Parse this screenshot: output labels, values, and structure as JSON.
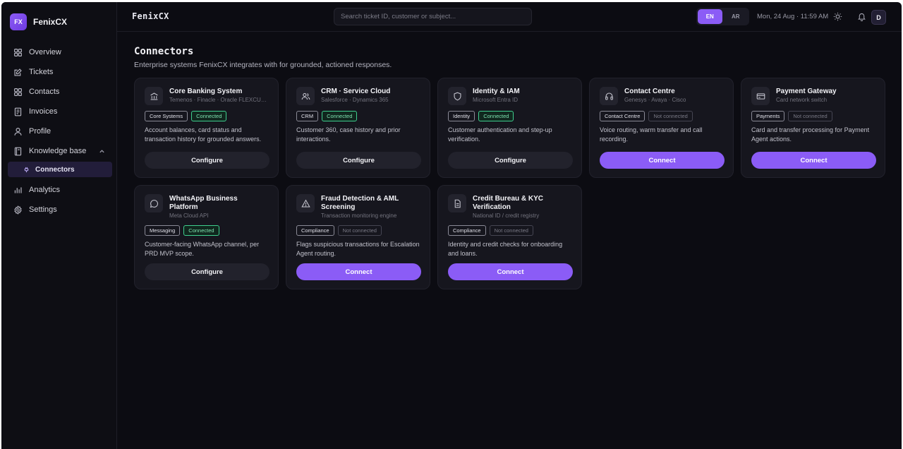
{
  "brand": {
    "logo": "FX",
    "name": "FenixCX"
  },
  "sidebar": {
    "items": [
      {
        "label": "Overview",
        "icon": "grid-icon"
      },
      {
        "label": "Tickets",
        "icon": "edit-icon"
      },
      {
        "label": "Contacts",
        "icon": "contacts-icon"
      },
      {
        "label": "Invoices",
        "icon": "invoice-icon"
      },
      {
        "label": "Profile",
        "icon": "user-icon"
      },
      {
        "label": "Knowledge base",
        "icon": "book-icon",
        "expanded": true
      },
      {
        "label": "Analytics",
        "icon": "bar-chart-icon"
      },
      {
        "label": "Settings",
        "icon": "gear-icon"
      }
    ],
    "sub_item": {
      "label": "Connectors",
      "icon": "plug-icon",
      "active": true
    }
  },
  "topbar": {
    "title": "FenixCX",
    "search_placeholder": "Search ticket ID, customer or subject...",
    "lang": {
      "en": "EN",
      "ar": "AR",
      "active": "EN"
    },
    "datetime": "Mon, 24 Aug · 11:59 AM",
    "avatar": "D"
  },
  "page": {
    "title": "Connectors",
    "subtitle": "Enterprise systems FenixCX integrates with for grounded, actioned responses."
  },
  "colors": {
    "accent": "#8b5cf6",
    "connected": "#3fcf8e",
    "background": "#0c0c12",
    "card": "#16161e"
  },
  "connectors": [
    {
      "title": "Core Banking System",
      "vendor": "Temenos · Finacle · Oracle FLEXCUBE",
      "category": "Core Systems",
      "status": "Connected",
      "connected": true,
      "desc": "Account balances, card status and transaction history for grounded answers.",
      "action": "Configure",
      "icon": "bank-icon"
    },
    {
      "title": "CRM · Service Cloud",
      "vendor": "Salesforce · Dynamics 365",
      "category": "CRM",
      "status": "Connected",
      "connected": true,
      "desc": "Customer 360, case history and prior interactions.",
      "action": "Configure",
      "icon": "users-icon"
    },
    {
      "title": "Identity & IAM",
      "vendor": "Microsoft Entra ID",
      "category": "Identity",
      "status": "Connected",
      "connected": true,
      "desc": "Customer authentication and step-up verification.",
      "action": "Configure",
      "icon": "shield-icon"
    },
    {
      "title": "Contact Centre",
      "vendor": "Genesys · Avaya · Cisco",
      "category": "Contact Centre",
      "status": "Not connected",
      "connected": false,
      "desc": "Voice routing, warm transfer and call recording.",
      "action": "Connect",
      "icon": "headset-icon"
    },
    {
      "title": "Payment Gateway",
      "vendor": "Card network switch",
      "category": "Payments",
      "status": "Not connected",
      "connected": false,
      "desc": "Card and transfer processing for Payment Agent actions.",
      "action": "Connect",
      "icon": "credit-card-icon"
    },
    {
      "title": "WhatsApp Business Platform",
      "vendor": "Meta Cloud API",
      "category": "Messaging",
      "status": "Connected",
      "connected": true,
      "desc": "Customer-facing WhatsApp channel, per PRD MVP scope.",
      "action": "Configure",
      "icon": "chat-bubble-icon"
    },
    {
      "title": "Fraud Detection & AML Screening",
      "vendor": "Transaction monitoring engine",
      "category": "Compliance",
      "status": "Not connected",
      "connected": false,
      "desc": "Flags suspicious transactions for Escalation Agent routing.",
      "action": "Connect",
      "icon": "warning-icon"
    },
    {
      "title": "Credit Bureau & KYC Verification",
      "vendor": "National ID / credit registry",
      "category": "Compliance",
      "status": "Not connected",
      "connected": false,
      "desc": "Identity and credit checks for onboarding and loans.",
      "action": "Connect",
      "icon": "document-icon"
    }
  ]
}
